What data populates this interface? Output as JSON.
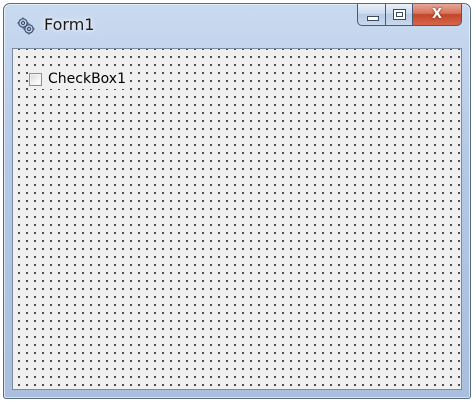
{
  "window": {
    "title": "Form1",
    "icon": "form-app-icon",
    "caption_buttons": [
      "minimize",
      "maximize",
      "close"
    ],
    "close_glyph": "X"
  },
  "form": {
    "grid": "dotted",
    "checkbox": {
      "label": "CheckBox1",
      "checked": false
    }
  },
  "colors": {
    "frame": "#b4c9e6",
    "close_button": "#c2452a",
    "client_background": "#f0f0f0"
  }
}
